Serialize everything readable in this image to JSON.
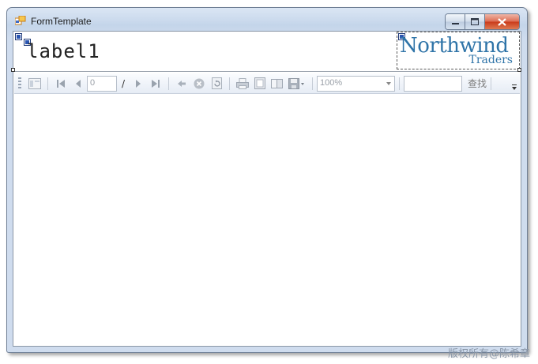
{
  "window": {
    "title": "FormTemplate",
    "controls": {
      "minimize": "minimize",
      "maximize": "maximize",
      "close": "close"
    }
  },
  "header": {
    "label_text": "label1",
    "logo": {
      "main": "Northwind",
      "sub": "Traders"
    }
  },
  "toolbar": {
    "page_value": "0",
    "page_separator": "/",
    "zoom_value": "100%",
    "search_value": "",
    "find_label": "查找"
  },
  "watermark": "版权所有@陈希章",
  "colors": {
    "logo": "#2f74a8",
    "close": "#c93a1a"
  }
}
